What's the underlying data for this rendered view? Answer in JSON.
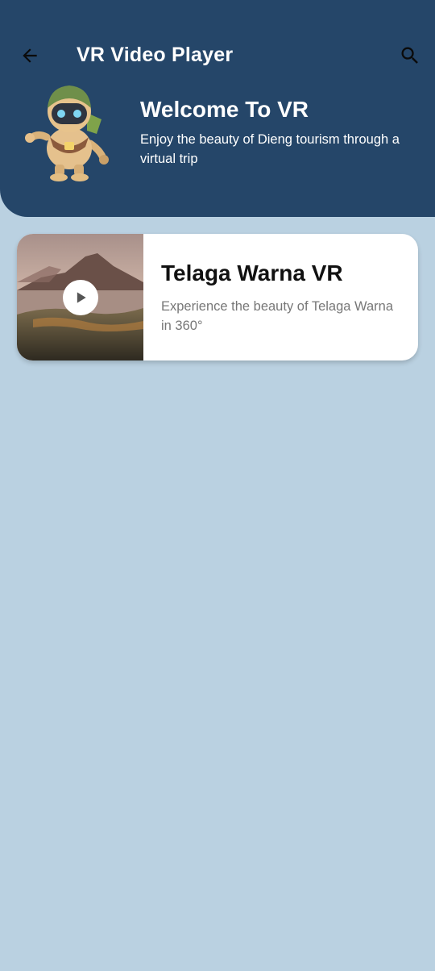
{
  "app_bar": {
    "title": "VR Video Player",
    "back_icon": "arrow-left-icon",
    "search_icon": "search-icon"
  },
  "hero": {
    "title": "Welcome To VR",
    "subtitle": "Enjoy the beauty of Dieng tourism through a virtual trip",
    "mascot": "robot-mascot"
  },
  "videos": [
    {
      "title": "Telaga Warna VR",
      "description": "Experience the beauty of Telaga Warna in 360°",
      "thumbnail": "mountain-landscape",
      "play_icon": "play-icon"
    }
  ],
  "colors": {
    "header_bg": "#254669",
    "page_bg": "#bad1e1",
    "card_bg": "#ffffff"
  }
}
